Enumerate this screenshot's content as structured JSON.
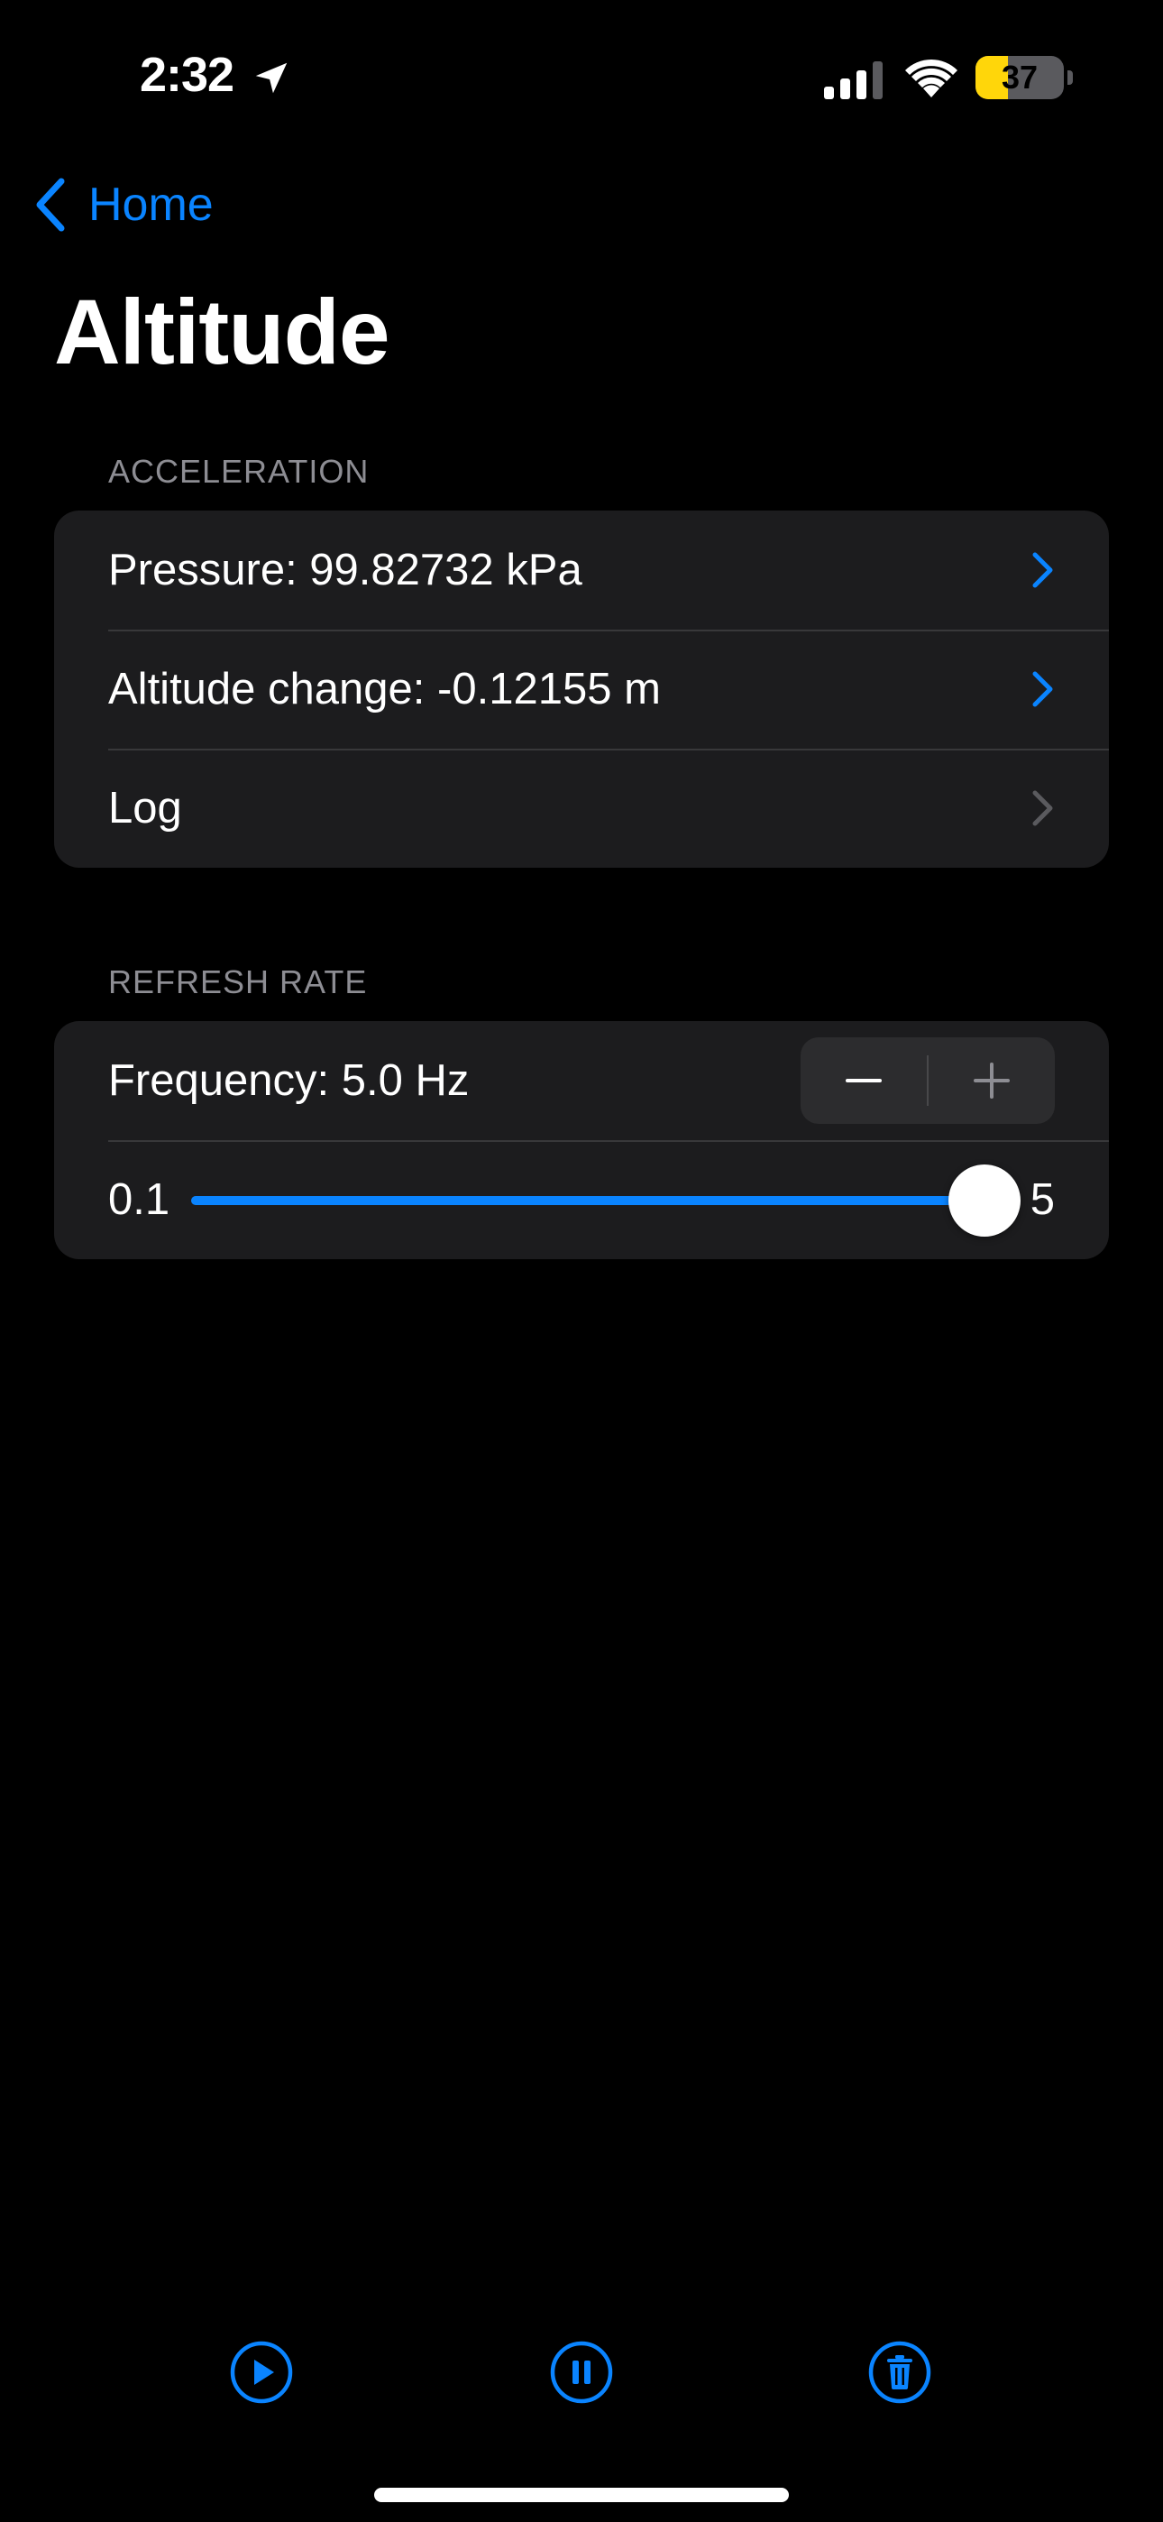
{
  "status_bar": {
    "time": "2:32",
    "battery_level": "37",
    "battery_fraction": 0.37,
    "icons": [
      "location-arrow-icon",
      "cellular-signal-icon",
      "wifi-icon",
      "battery-icon"
    ]
  },
  "nav": {
    "back_label": "Home",
    "title": "Altitude"
  },
  "sections": {
    "acceleration": {
      "header": "ACCELERATION",
      "rows": [
        {
          "label": "Pressure: 99.82732 kPa"
        },
        {
          "label": "Altitude change: -0.12155 m"
        },
        {
          "label": "Log"
        }
      ]
    },
    "refresh_rate": {
      "header": "REFRESH RATE",
      "frequency_label": "Frequency: 5.0 Hz",
      "stepper": {
        "minus": "−",
        "plus": "+"
      },
      "slider": {
        "min_label": "0.1",
        "max_label": "5",
        "min": 0.1,
        "max": 5,
        "value": 5.0
      }
    }
  },
  "toolbar": {
    "buttons": [
      "play-icon",
      "pause-icon",
      "trash-icon"
    ]
  },
  "colors": {
    "accent": "#0a84ff",
    "background": "#000000",
    "group_background": "#1c1c1e",
    "secondary_text": "#8d8d93",
    "battery_fill": "#ffd60a"
  }
}
